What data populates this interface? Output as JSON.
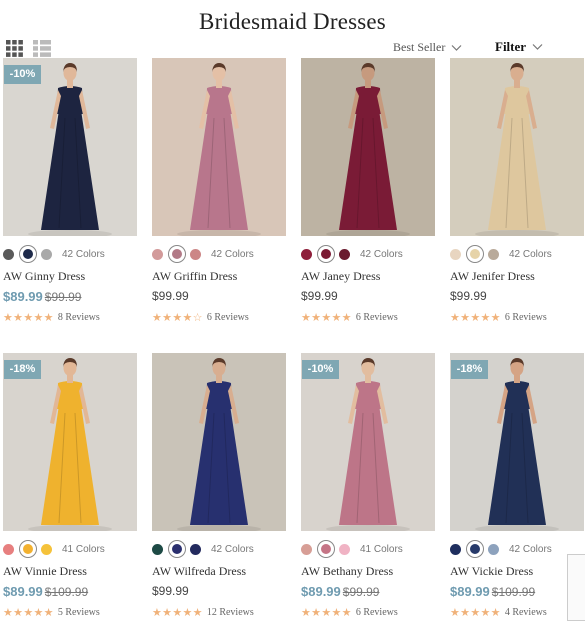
{
  "page": {
    "title": "Bridesmaid Dresses"
  },
  "toolbar": {
    "grid_view_icon": "grid-view-icon",
    "list_view_icon": "list-view-icon",
    "sort_label": "Best Seller",
    "filter_label": "Filter"
  },
  "colors": {
    "accent_price": "#6f9bb0",
    "badge_bg": "#7fa7b3",
    "star": "#f0b27a"
  },
  "products": [
    {
      "name": "AW Ginny Dress",
      "price": "$89.99",
      "old_price": "$99.99",
      "discount": "-10%",
      "colors_label": "42 Colors",
      "reviews": "8 Reviews",
      "stars": "★★★★★",
      "swatches": [
        "#5a5a5a",
        "#1e2a4a",
        "#a9a9a9"
      ],
      "selected": 1,
      "dress": "#1d2440",
      "bg": "#d9d6d0",
      "skin": "#e0b89a"
    },
    {
      "name": "AW Griffin Dress",
      "price": "$99.99",
      "old_price": "",
      "discount": "",
      "colors_label": "42 Colors",
      "reviews": "6 Reviews",
      "stars": "★★★★☆",
      "swatches": [
        "#d29a9a",
        "#b27a87",
        "#cc8686"
      ],
      "selected": 1,
      "dress": "#b8768c",
      "bg": "#d8c6b8",
      "skin": "#e4c0a6"
    },
    {
      "name": "AW Janey Dress",
      "price": "$99.99",
      "old_price": "",
      "discount": "",
      "colors_label": "42 Colors",
      "reviews": "6 Reviews",
      "stars": "★★★★★",
      "swatches": [
        "#8e1e3a",
        "#7a1a33",
        "#6a1a2e"
      ],
      "selected": 1,
      "dress": "#7a1b36",
      "bg": "#bdb3a3",
      "skin": "#c69a7e"
    },
    {
      "name": "AW Jenifer Dress",
      "price": "$99.99",
      "old_price": "",
      "discount": "",
      "colors_label": "42 Colors",
      "reviews": "6 Reviews",
      "stars": "★★★★★",
      "swatches": [
        "#e8d5c0",
        "#e6d3a8",
        "#b9aa9a"
      ],
      "selected": 1,
      "dress": "#dec79e",
      "bg": "#d4cdbd",
      "skin": "#d9ae8f"
    },
    {
      "name": "AW Vinnie Dress",
      "price": "$89.99",
      "old_price": "$109.99",
      "discount": "-18%",
      "colors_label": "41 Colors",
      "reviews": "5 Reviews",
      "stars": "★★★★★",
      "swatches": [
        "#e77f7f",
        "#f2b130",
        "#f5c23a"
      ],
      "selected": 1,
      "dress": "#efb22e",
      "bg": "#d8d4ce",
      "skin": "#e2b796"
    },
    {
      "name": "AW Wilfreda Dress",
      "price": "$99.99",
      "old_price": "",
      "discount": "",
      "colors_label": "42 Colors",
      "reviews": "12 Reviews",
      "stars": "★★★★★",
      "swatches": [
        "#1d4a45",
        "#2a2f6e",
        "#232a5e"
      ],
      "selected": 1,
      "dress": "#27306f",
      "bg": "#c9c3b8",
      "skin": "#d8ae90"
    },
    {
      "name": "AW Bethany Dress",
      "price": "$89.99",
      "old_price": "$99.99",
      "discount": "-10%",
      "colors_label": "41 Colors",
      "reviews": "6 Reviews",
      "stars": "★★★★★",
      "swatches": [
        "#d79e96",
        "#c57586",
        "#f0b3c4"
      ],
      "selected": 1,
      "dress": "#bd7588",
      "bg": "#d8d3cd",
      "skin": "#e2bd9f"
    },
    {
      "name": "AW Vickie Dress",
      "price": "$89.99",
      "old_price": "$109.99",
      "discount": "-18%",
      "colors_label": "42 Colors",
      "reviews": "4 Reviews",
      "stars": "★★★★★",
      "swatches": [
        "#1f2e5e",
        "#273a6a",
        "#8da2bd"
      ],
      "selected": 1,
      "dress": "#213056",
      "bg": "#d4d2cd",
      "skin": "#d5a485"
    }
  ]
}
